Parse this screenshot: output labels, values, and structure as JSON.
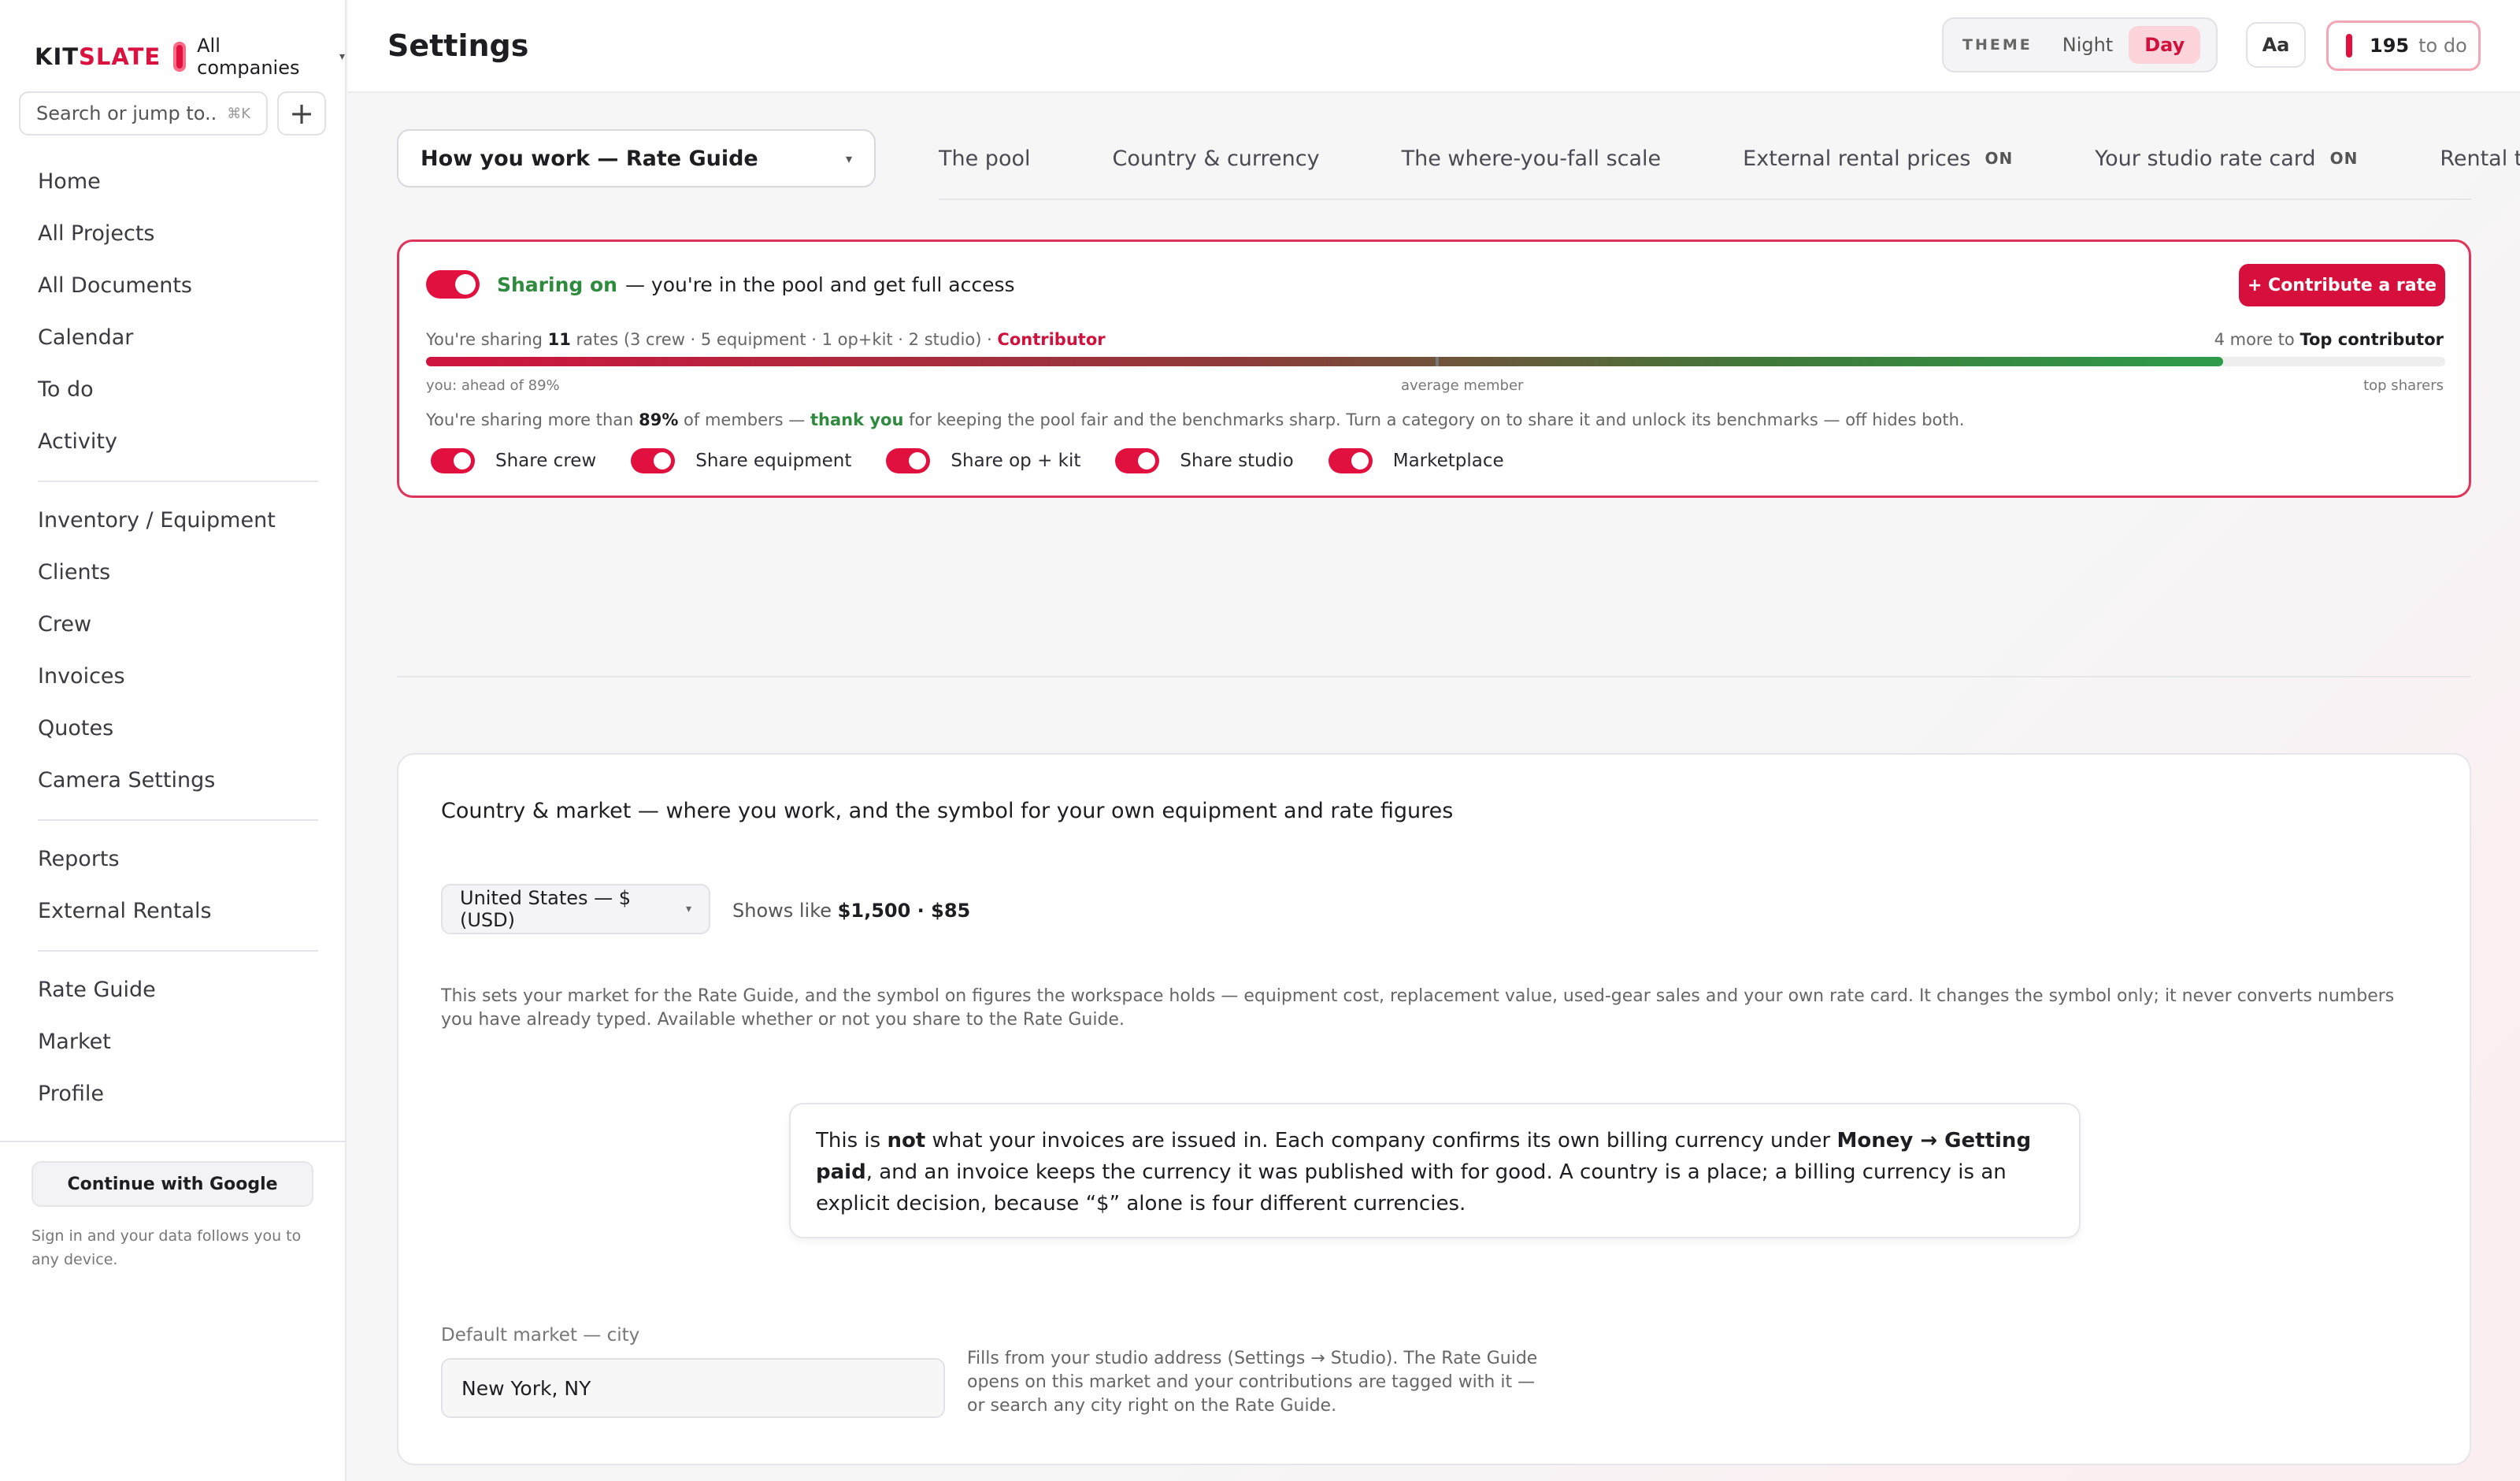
{
  "sidebar": {
    "brand_prefix": "KIT",
    "brand_suffix": "SLATE",
    "company": "All companies",
    "search_placeholder": "Search or jump to...",
    "search_shortcut": "⌘K",
    "add_label": "+",
    "groups": [
      [
        "Home",
        "All Projects",
        "All Documents",
        "Calendar",
        "To do",
        "Activity"
      ],
      [
        "Inventory / Equipment",
        "Clients",
        "Crew",
        "Invoices",
        "Quotes",
        "Camera Settings"
      ],
      [
        "Reports",
        "External Rentals"
      ],
      [
        "Rate Guide",
        "Market",
        "Profile"
      ]
    ],
    "google_button": "Continue with Google",
    "google_note": "Sign in and your data follows you to any device."
  },
  "header": {
    "title": "Settings",
    "theme_label": "THEME",
    "theme_night": "Night",
    "theme_day": "Day",
    "font_button": "Aa",
    "todo_count": "195",
    "todo_label": "to do"
  },
  "section_select": {
    "value": "How you work — Rate Guide"
  },
  "tabs": [
    {
      "label": "The pool",
      "badge": ""
    },
    {
      "label": "Country & currency",
      "badge": ""
    },
    {
      "label": "The where-you-fall scale",
      "badge": ""
    },
    {
      "label": "External rental prices",
      "badge": "ON"
    },
    {
      "label": "Your studio rate card",
      "badge": "ON"
    },
    {
      "label": "Rental terms",
      "badge": ""
    }
  ],
  "sharing": {
    "status": "Sharing on",
    "status_rest": "— you're in the pool and get full access",
    "contribute_button": "+ Contribute a rate",
    "stats_prefix": "You're sharing ",
    "stats_count": "11",
    "stats_rest": " rates (3 crew · 5 equipment · 1 op+kit · 2 studio) · ",
    "tier": "Contributor",
    "next_prefix": "4 more to ",
    "next_tier": "Top contributor",
    "progress_fraction": 0.89,
    "average_fraction": 0.5,
    "scale_left": "you: ahead of 89%",
    "scale_mid": "average member",
    "scale_right": "top sharers",
    "desc_prefix": "You're sharing more than ",
    "desc_pct": "89%",
    "desc_mid": " of members — ",
    "desc_thanks": "thank you",
    "desc_rest": " for keeping the pool fair and the benchmarks sharp. Turn a category on to share it and unlock its benchmarks — off hides both.",
    "toggles": [
      "Share crew",
      "Share equipment",
      "Share op + kit",
      "Share studio",
      "Marketplace"
    ]
  },
  "market": {
    "title": "Country & market — where you work, and the symbol for your own equipment and rate figures",
    "country_value": "United States — $ (USD)",
    "shows_like_prefix": "Shows like ",
    "shows_like_value": "$1,500 · $85",
    "description": "This sets your market for the Rate Guide, and the symbol on figures the workspace holds — equipment cost, replacement value, used-gear sales and your own rate card. It changes the symbol only; it never converts numbers you have already typed. Available whether or not you share to the Rate Guide.",
    "notice_1": "This is ",
    "notice_not": "not",
    "notice_2": " what your invoices are issued in. Each company confirms its own billing currency under ",
    "notice_path": "Money → Getting paid",
    "notice_3": ", and an invoice keeps the currency it was published with for good. A country is a place; a billing currency is an explicit decision, because “$” alone is four different currencies.",
    "city_label": "Default market — city",
    "city_value": "New York, NY",
    "city_help": "Fills from your studio address (Settings → Studio). The Rate Guide opens on this market and your contributions are tagged with it — or search any city right on the Rate Guide."
  }
}
